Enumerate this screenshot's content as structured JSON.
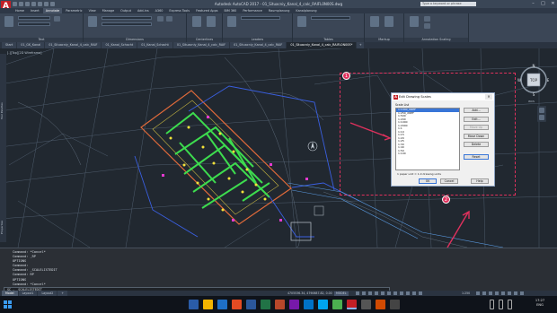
{
  "window": {
    "title": "Autodesk AutoCAD 2017 - 01_Situacniy_Kanal_4_calc_RAIFL0N00S.dwg",
    "search_placeholder": "Type a keyword or phrase"
  },
  "ribbon": {
    "tabs": [
      "Home",
      "Insert",
      "Annotate",
      "Parametric",
      "View",
      "Manage",
      "Output",
      "Add-ins",
      "A360",
      "Express Tools",
      "Featured Apps",
      "BIM 360",
      "Performance",
      "Raumplanung",
      "Kanalplanung"
    ],
    "active_tab": "Annotate",
    "panels": [
      "Text",
      "Dimensions",
      "Centerlines",
      "Leaders",
      "Tables",
      "Markup",
      "Annotation Scaling"
    ]
  },
  "doc_tabs": [
    "Start",
    "01_GK_Kanal",
    "01_Situacniy_Kanal_4_calc_RAIF",
    "01_Kanal_Schacht",
    "01_Kanal_Schacht",
    "01_Situacniy_Kanal_4_calc_RAIF",
    "01_Situacniy_Kanal_4_calc_RAIF",
    "01_Situacniy_Kanal_4_calc_RAIFL0N00S*",
    "+"
  ],
  "viewport_label": "[-][Top][2D Wireframe]",
  "palette_tabs": [
    "Tool Palettes",
    "Properties"
  ],
  "viewcube": {
    "top": "TOP",
    "n": "N",
    "s": "S",
    "e": "E",
    "w": "W",
    "wcs": "WCS"
  },
  "callouts": {
    "one": "1",
    "two": "2"
  },
  "dialog": {
    "title": "Edit Drawing Scales",
    "close": "✕",
    "scale_list_label": "Scale List",
    "scales": [
      "1:1000_XREF",
      "1:250_XREF",
      "1:500",
      "1:200",
      "1:1000",
      "1:2000",
      "1:1",
      "1:10",
      "1:15",
      "1:20",
      "1:25",
      "1:30",
      "1:40",
      "1:50",
      "1:100"
    ],
    "selected_index": 0,
    "buttons": {
      "add": "Add...",
      "edit": "Edit...",
      "move_up": "Move Up",
      "move_down": "Move Down",
      "delete": "Delete",
      "reset": "Reset"
    },
    "unit_info": "1 paper unit = 1.0 drawing units",
    "footer": {
      "ok": "OK",
      "cancel": "Cancel",
      "help": "Help"
    }
  },
  "command_history": [
    "Command: *Cancel*",
    "Command: _RP",
    "OPTIONS",
    "Command:",
    "Command: _SCALELISTEDIT",
    "Command: RP",
    "OPTIONS",
    "Command: *Cancel*"
  ],
  "command_prompt": "SC - _SCALELISTEDIT",
  "layout_tabs": [
    "Model",
    "Layout1",
    "Layout2",
    "+"
  ],
  "status": {
    "coords": "4705536.34, 4790687.82, 0.00",
    "model": "MODEL",
    "zoom": "1:250"
  },
  "clock": {
    "time": "17:27",
    "date": "ENG"
  },
  "colors": {
    "accent": "#e0315d",
    "autocad_red": "#c21f26",
    "selection": "#3875d7"
  }
}
